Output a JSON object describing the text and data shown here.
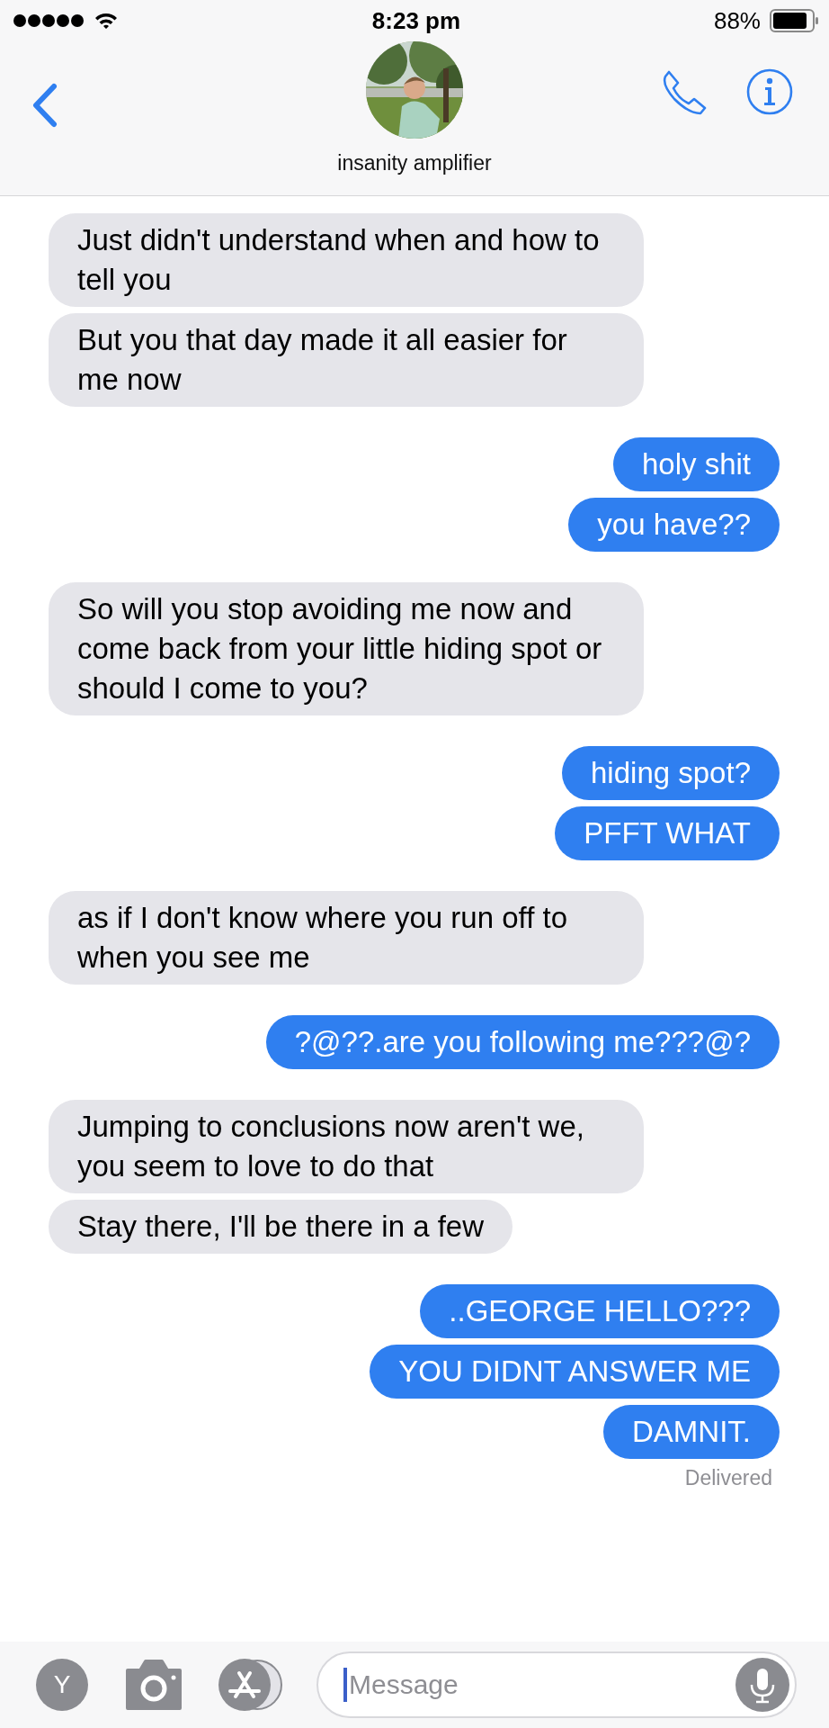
{
  "status_bar": {
    "time": "8:23 pm",
    "battery": "88%"
  },
  "contact": {
    "name": "insanity amplifier"
  },
  "messages": [
    {
      "kind": "received",
      "text": "Just didn't understand when and how to tell you"
    },
    {
      "kind": "received",
      "text": "But you that day made it all easier for me now"
    },
    {
      "kind": "sent",
      "text": "holy shit"
    },
    {
      "kind": "sent",
      "text": "you have??"
    },
    {
      "kind": "received",
      "text": "So will you stop avoiding me now and come back from your little hiding spot or should I come to you?"
    },
    {
      "kind": "sent",
      "text": "hiding spot?"
    },
    {
      "kind": "sent",
      "text": "PFFT WHAT"
    },
    {
      "kind": "received",
      "text": "as if I don't know where you run off to when you see me"
    },
    {
      "kind": "sent",
      "text": "?@??.are you following me???@?"
    },
    {
      "kind": "received",
      "text": "Jumping to conclusions now aren't we, you seem to love to do that"
    },
    {
      "kind": "received",
      "text": "Stay there, I'll be there in a few"
    },
    {
      "kind": "sent",
      "text": "..GEORGE HELLO???"
    },
    {
      "kind": "sent",
      "text": "YOU DIDNT ANSWER ME"
    },
    {
      "kind": "sent",
      "text": "DAMNIT."
    }
  ],
  "delivery_status": "Delivered",
  "composer": {
    "profile_letter": "Y",
    "placeholder": "Message"
  }
}
